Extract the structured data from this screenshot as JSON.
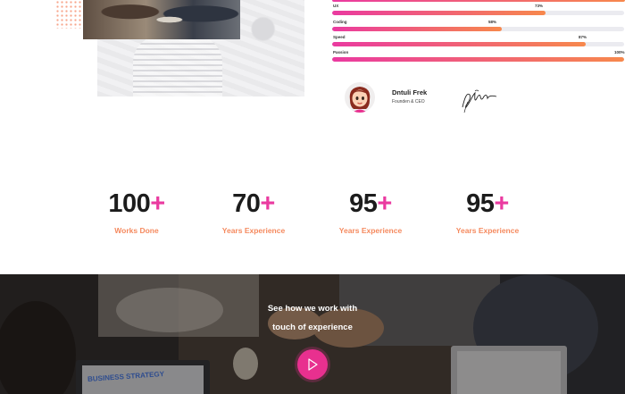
{
  "skills": [
    {
      "label": "UX",
      "percent": "73%",
      "value": 0.73
    },
    {
      "label": "Coding",
      "percent": "58%",
      "value": 0.58
    },
    {
      "label": "Speed",
      "percent": "87%",
      "value": 0.87
    },
    {
      "label": "Passion",
      "percent": "100%",
      "value": 1.0
    }
  ],
  "profile": {
    "name": "Dntuli Frek",
    "role": "Founden & CEO"
  },
  "stats": [
    {
      "value": "100",
      "suffix": "+",
      "label": "Works Done"
    },
    {
      "value": "70",
      "suffix": "+",
      "label": "Years Experience"
    },
    {
      "value": "95",
      "suffix": "+",
      "label": "Years Experience"
    },
    {
      "value": "95",
      "suffix": "+",
      "label": "Years Experience"
    }
  ],
  "banner": {
    "line1": "See how we work with",
    "line2": "touch of experience",
    "board_text": "BUSINESS STRATEGY"
  },
  "icons": {
    "play": "play-icon",
    "signature": "signature-icon"
  },
  "colors": {
    "accent_pink": "#ea3aa0",
    "accent_orange": "#f58a5f",
    "play_button": "#e8308f"
  }
}
